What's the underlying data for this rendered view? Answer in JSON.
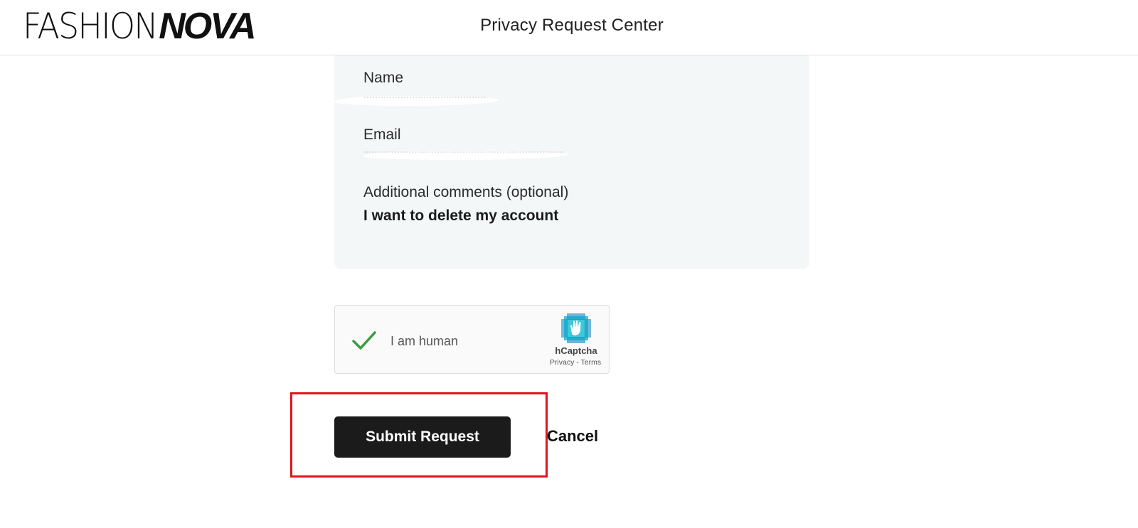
{
  "header": {
    "logo_light": "FASHION",
    "logo_bold": "NOVA",
    "title": "Privacy Request Center"
  },
  "summary": {
    "name_label": "Name",
    "email_label": "Email",
    "comments_label": "Additional comments (optional)",
    "comments_value": "I want to delete my account"
  },
  "captcha": {
    "label": "I am human",
    "brand": "hCaptcha",
    "links": "Privacy - Terms",
    "checked": true
  },
  "actions": {
    "submit_label": "Submit Request",
    "cancel_label": "Cancel"
  },
  "colors": {
    "accent": "#1b1b1b",
    "highlight": "#e0141e",
    "panel_bg": "#f4f7f7",
    "check": "#3c9b3c"
  }
}
